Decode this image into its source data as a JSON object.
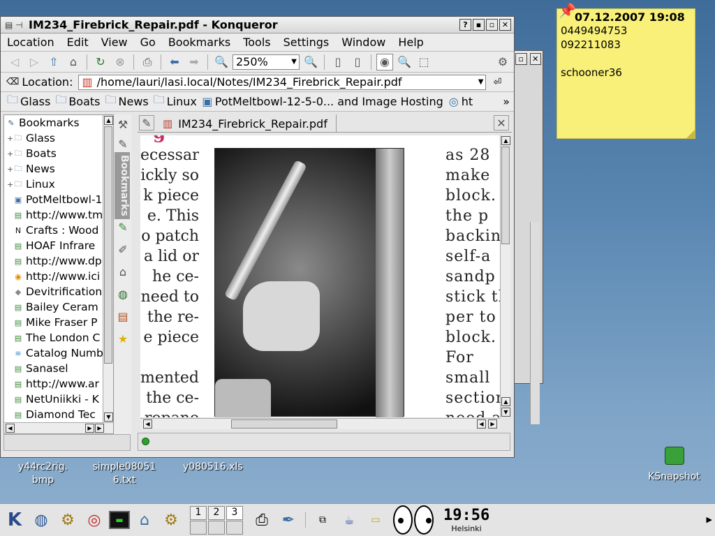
{
  "window": {
    "title": "IM234_Firebrick_Repair.pdf - Konqueror",
    "help_btn": "?"
  },
  "menu": [
    "Location",
    "Edit",
    "View",
    "Go",
    "Bookmarks",
    "Tools",
    "Settings",
    "Window",
    "Help"
  ],
  "toolbar": {
    "zoom": "250%"
  },
  "location": {
    "label": "Location:",
    "url": "/home/lauri/lasi.local/Notes/IM234_Firebrick_Repair.pdf"
  },
  "bookmark_bar": [
    "Glass",
    "Boats",
    "News",
    "Linux",
    "PotMeltbowl-12-5-0... and Image Hosting",
    "ht"
  ],
  "bookmark_bar_more": "»",
  "sidebar": {
    "title": "Bookmarks",
    "tab_label": "Bookmarks",
    "items": [
      {
        "label": "Glass",
        "type": "folder"
      },
      {
        "label": "Boats",
        "type": "folder"
      },
      {
        "label": "News",
        "type": "folder"
      },
      {
        "label": "Linux",
        "type": "folder"
      },
      {
        "label": "PotMeltbowl-1",
        "type": "image"
      },
      {
        "label": "http://www.tm",
        "type": "page"
      },
      {
        "label": "Crafts : Wood",
        "type": "n"
      },
      {
        "label": "HOAF Infrare",
        "type": "page"
      },
      {
        "label": "http://www.dp",
        "type": "page"
      },
      {
        "label": "http://www.ici",
        "type": "orange"
      },
      {
        "label": "Devitrification",
        "type": "apple"
      },
      {
        "label": "Bailey Ceram",
        "type": "page"
      },
      {
        "label": "Mike Fraser P",
        "type": "page"
      },
      {
        "label": "The London C",
        "type": "page"
      },
      {
        "label": "Catalog Numb",
        "type": "cat"
      },
      {
        "label": "Sanasel",
        "type": "page"
      },
      {
        "label": "http://www.ar",
        "type": "page"
      },
      {
        "label": "NetUniikki - K",
        "type": "page"
      },
      {
        "label": "Diamond Tec",
        "type": "page"
      }
    ]
  },
  "tab": {
    "label": "IM234_Firebrick_Repair.pdf"
  },
  "document": {
    "left_lines": [
      "ecessary",
      "ickly so",
      "k piece",
      "e. This",
      "o patch",
      "a lid or",
      "he ce-",
      "need to",
      "the re-",
      "e piece",
      "",
      "mented",
      "the ce-",
      "ropane"
    ],
    "right_lines": [
      "as 28",
      "make",
      "block.",
      "the p",
      "backin",
      "self-a",
      "sandp",
      "stick th",
      "per to t",
      "block.",
      "For",
      "small",
      "section",
      "need a"
    ],
    "top_fragment": "g"
  },
  "note": {
    "datetime": "07.12.2007 19:08",
    "lines": [
      "0449494753",
      "092211083",
      "",
      "schooner36"
    ]
  },
  "desktop_icons": [
    {
      "label": "y44rc2rig.\nbmp"
    },
    {
      "label": "simple08051\n6.txt"
    },
    {
      "label": "y080516.xls"
    },
    {
      "label": "KSnapshot"
    }
  ],
  "taskbar": {
    "desktops": [
      "1",
      "2",
      "3"
    ],
    "clock": "19:56",
    "city": "Helsinki"
  },
  "colors": {
    "note_bg": "#f8f078",
    "desktop": "#5a87b2",
    "pdf_icon": "#c0392b"
  }
}
